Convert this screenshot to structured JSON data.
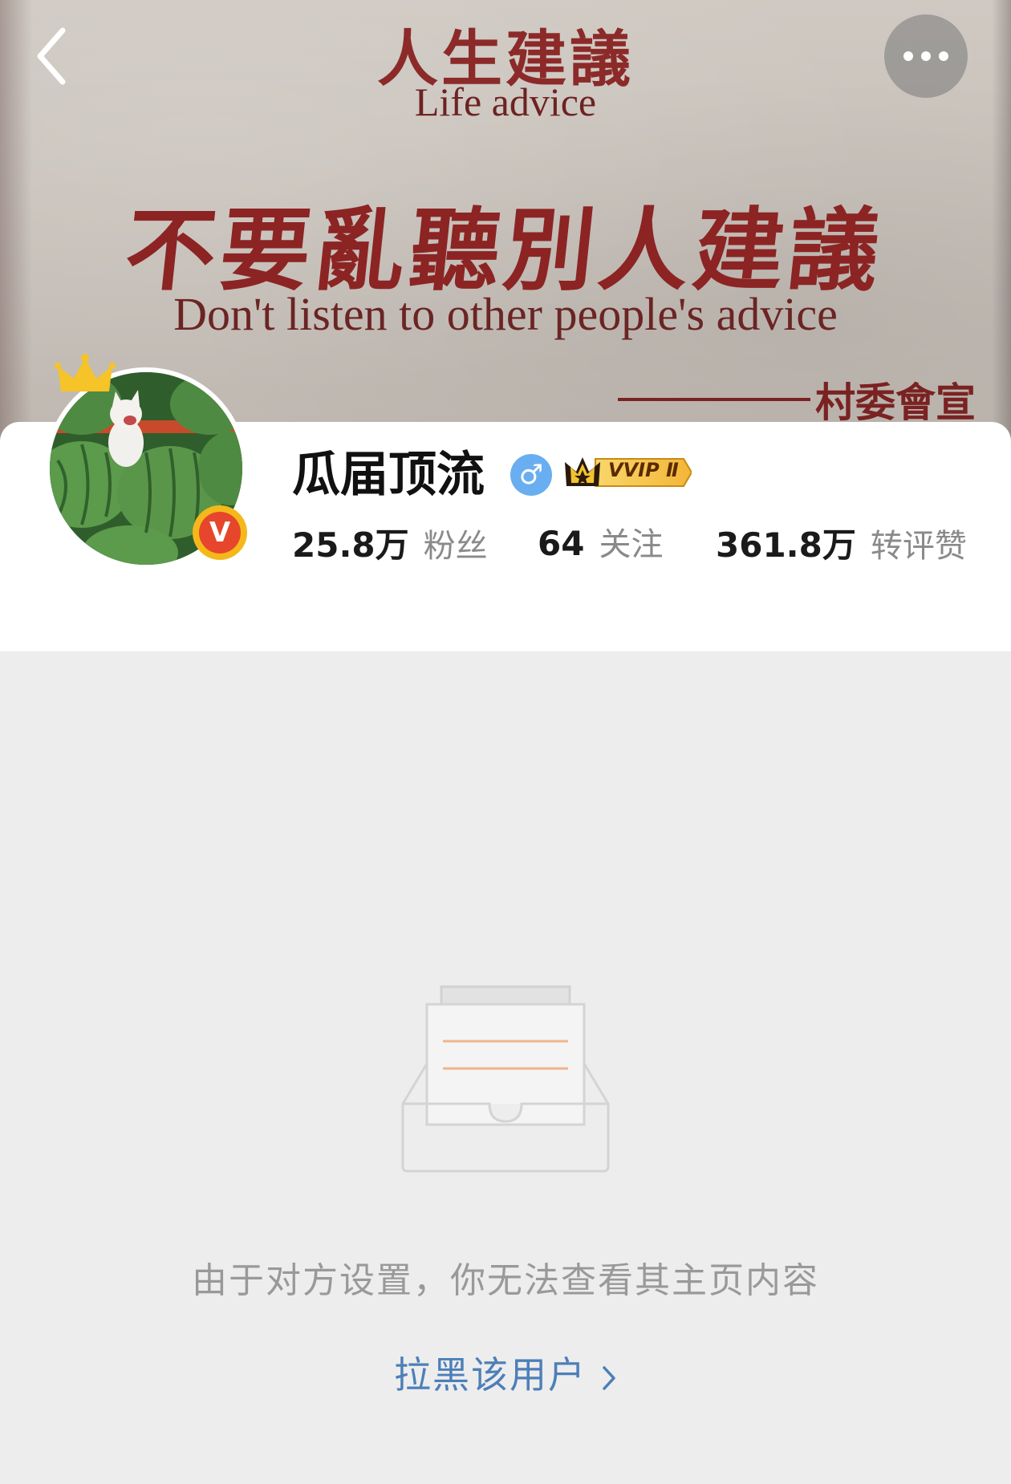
{
  "banner": {
    "title_cn": "人生建議",
    "title_en": "Life advice",
    "headline_cn": "不要亂聽別人建議",
    "headline_en": "Don't listen to other people's advice",
    "signature": "村委會宣"
  },
  "nav": {
    "back_icon": "chevron-left-icon",
    "more_icon": "more-dots-icon"
  },
  "profile": {
    "username": "瓜届顶流",
    "gender_symbol": "♂",
    "verified_mark": "V",
    "vip_badge": "VVIP Ⅱ",
    "stats": [
      {
        "value": "25.8万",
        "label": "粉丝"
      },
      {
        "value": "64",
        "label": "关注"
      },
      {
        "value": "361.8万",
        "label": "转评赞"
      }
    ]
  },
  "empty_state": {
    "icon": "empty-box-icon",
    "message": "由于对方设置，你无法查看其主页内容",
    "action_label": "拉黑该用户"
  },
  "colors": {
    "link_blue": "#4d7fb8",
    "gender_blue": "#69aef0",
    "vip_gold": "#f5b81b",
    "banner_red": "#8c2424",
    "background": "#ededed"
  }
}
